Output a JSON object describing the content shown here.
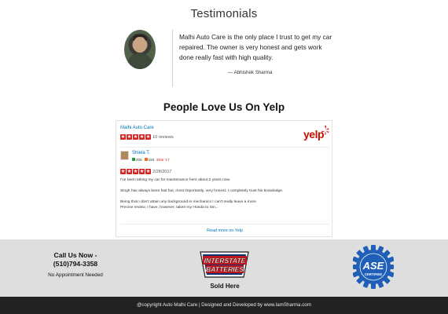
{
  "testimonials": {
    "title": "Testimonials",
    "quote": "Malhi Auto Care is the only place I trust to get my car repaired. The owner is very honest and gets work done really fast with high quality.",
    "author": "— Abhishek Sharma"
  },
  "yelp": {
    "title": "People Love Us On Yelp",
    "business_name": "Malhi Auto Care",
    "business_rating": 5,
    "review_count": "10 reviews",
    "logo_text": "yelp",
    "brand_color": "#d32323",
    "review": {
      "reviewer_name": "Shiela T.",
      "friends_count": "206",
      "reviews_count": "184",
      "elite_label": "Elite '17",
      "rating": 5,
      "date": "2/28/2017",
      "paragraphs": [
        "I've been taking my car for maintenance here about 2 years now.",
        "Singh has always been fast but, most importantly, very honest. I completely trust his knowledge.",
        "Being that I don't attain any background in mechanics I can't really leave a more",
        "Precise review. I have, however, taken my Honda to Sin..."
      ]
    },
    "read_more": "Read more on Yelp"
  },
  "footer": {
    "call_title": "Call Us Now -",
    "phone": "(510)794-3358",
    "appointment_note": "No Appointment Needed",
    "interstate_line1": "INTERSTATE",
    "interstate_line2": "BATTERIES",
    "sold_here": "Sold Here",
    "ase_text": "ASE",
    "ase_subtext": "CERTIFIED",
    "ase_color": "#1f5fb8"
  },
  "copyright": "@copyright Auto Malhi Care | Designed and Developed by www.IamSharma.com"
}
